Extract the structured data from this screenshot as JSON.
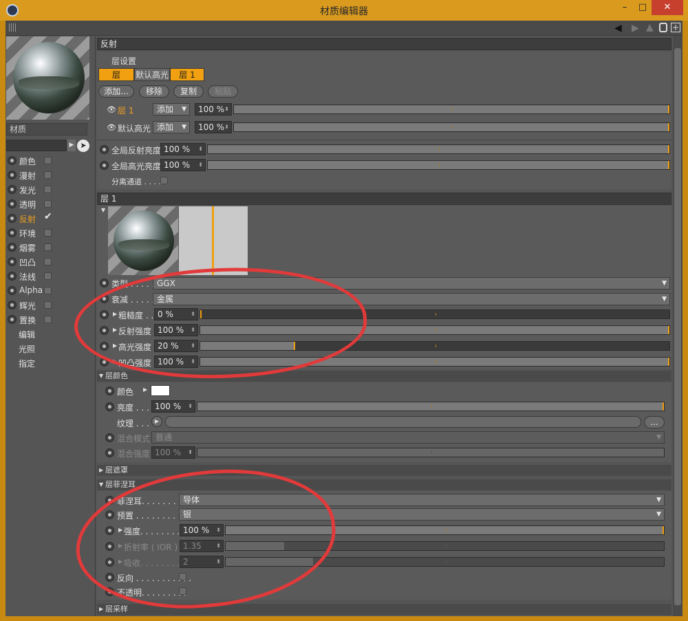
{
  "window": {
    "title": "材质编辑器",
    "minimize": "–",
    "maximize": "□",
    "close": "✕"
  },
  "left": {
    "material_name": "材质",
    "channels": [
      {
        "label": "颜色",
        "checked": false
      },
      {
        "label": "漫射",
        "checked": false
      },
      {
        "label": "发光",
        "checked": false
      },
      {
        "label": "透明",
        "checked": false
      },
      {
        "label": "反射",
        "checked": true,
        "active": true
      },
      {
        "label": "环境",
        "checked": false
      },
      {
        "label": "烟雾",
        "checked": false
      },
      {
        "label": "凹凸",
        "checked": false
      },
      {
        "label": "法线",
        "checked": false
      },
      {
        "label": "Alpha",
        "checked": false
      },
      {
        "label": "辉光",
        "checked": false
      },
      {
        "label": "置换",
        "checked": false
      }
    ],
    "extras": [
      "编辑",
      "光照",
      "指定"
    ]
  },
  "reflect": {
    "header": "反射",
    "layer_settings": "层设置",
    "tabs": [
      "层",
      "默认高光",
      "层 1"
    ],
    "buttons": {
      "add": "添加...",
      "remove": "移除",
      "copy": "复制",
      "paste": "粘贴"
    },
    "layers": [
      {
        "name": "层 1",
        "mode": "添加",
        "value": "100 %"
      },
      {
        "name": "默认高光",
        "mode": "添加",
        "value": "100 %"
      }
    ],
    "global_reflect_label": "全局反射亮度",
    "global_reflect_value": "100 %",
    "global_spec_label": "全局高光亮度",
    "global_spec_value": "100 %",
    "separate_pass": "分离通道 . . . ."
  },
  "layer1": {
    "header": "层 1",
    "type_label": "类型 . . . . .",
    "type_value": "GGX",
    "atten_label": "衰减 . . . . .",
    "atten_value": "金属",
    "roughness_label": "粗糙度 . .",
    "roughness_value": "0 %",
    "reflect_strength_label": "反射强度",
    "reflect_strength_value": "100 %",
    "spec_strength_label": "高光强度",
    "spec_strength_value": "20 %",
    "bump_strength_label": "凹凸强度",
    "bump_strength_value": "100 %",
    "levels": {
      "roughness": 0.0,
      "reflect": 1.0,
      "spec": 0.2,
      "bump": 1.0
    }
  },
  "layer_color": {
    "header": "层颜色",
    "color_label": "颜色",
    "brightness_label": "亮度 . . .",
    "brightness_value": "100 %",
    "texture_label": "纹理 . . .",
    "texture_btn": "...",
    "blend_mode_label": "混合模式",
    "blend_mode_value": "普通",
    "blend_strength_label": "混合强度",
    "blend_strength_value": "100 %"
  },
  "layer_mask": {
    "header": "层遮罩"
  },
  "layer_fresnel": {
    "header": "层菲涅耳",
    "fresnel_label": "菲涅耳. . . . . . . . .",
    "fresnel_value": "导体",
    "preset_label": "预置 . . . . . . . . . . .",
    "preset_value": "银",
    "strength_label": "强度. . . . . . . . .",
    "strength_value": "100 %",
    "ior_label": "折射率 ( IOR )",
    "ior_value": "1.35",
    "absorb_label": "吸收. . . . . . . . .",
    "absorb_value": "2",
    "invert_label": "反向 . . . . . . . . . . .",
    "opaque_label": "不透明. . . . . . . . ."
  },
  "layer_sample": {
    "header": "层采样"
  },
  "colors": {
    "accent": "#f0a010",
    "annotation": "#e23a3a"
  }
}
